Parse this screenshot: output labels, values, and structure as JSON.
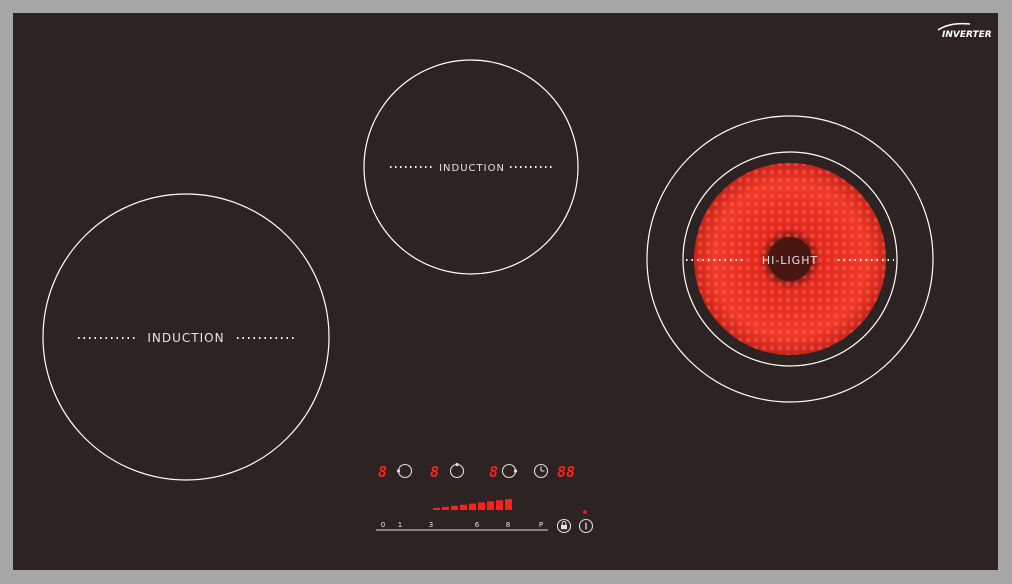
{
  "brand": {
    "logo_text": "INVERTER"
  },
  "zones": [
    {
      "label": "INDUCTION"
    },
    {
      "label": "INDUCTION"
    },
    {
      "label": "HI-LIGHT"
    }
  ],
  "displays": {
    "zone_1": "8",
    "zone_2": "8",
    "zone_3": "8",
    "timer": "88"
  },
  "power_scale": {
    "labels": [
      "0",
      "1",
      "3",
      "6",
      "8",
      "P"
    ],
    "level_fraction": 1.0
  },
  "icons": {
    "zone_select_1": "zone-left-icon",
    "zone_select_2": "zone-rear-icon",
    "zone_select_3": "zone-right-icon",
    "timer": "clock-icon",
    "lock": "lock-icon",
    "power": "power-icon"
  },
  "colors": {
    "glass": "#2e2323",
    "frame": "#a6a6a6",
    "led_red": "#ff2020",
    "heating_red": "#e0281e"
  }
}
